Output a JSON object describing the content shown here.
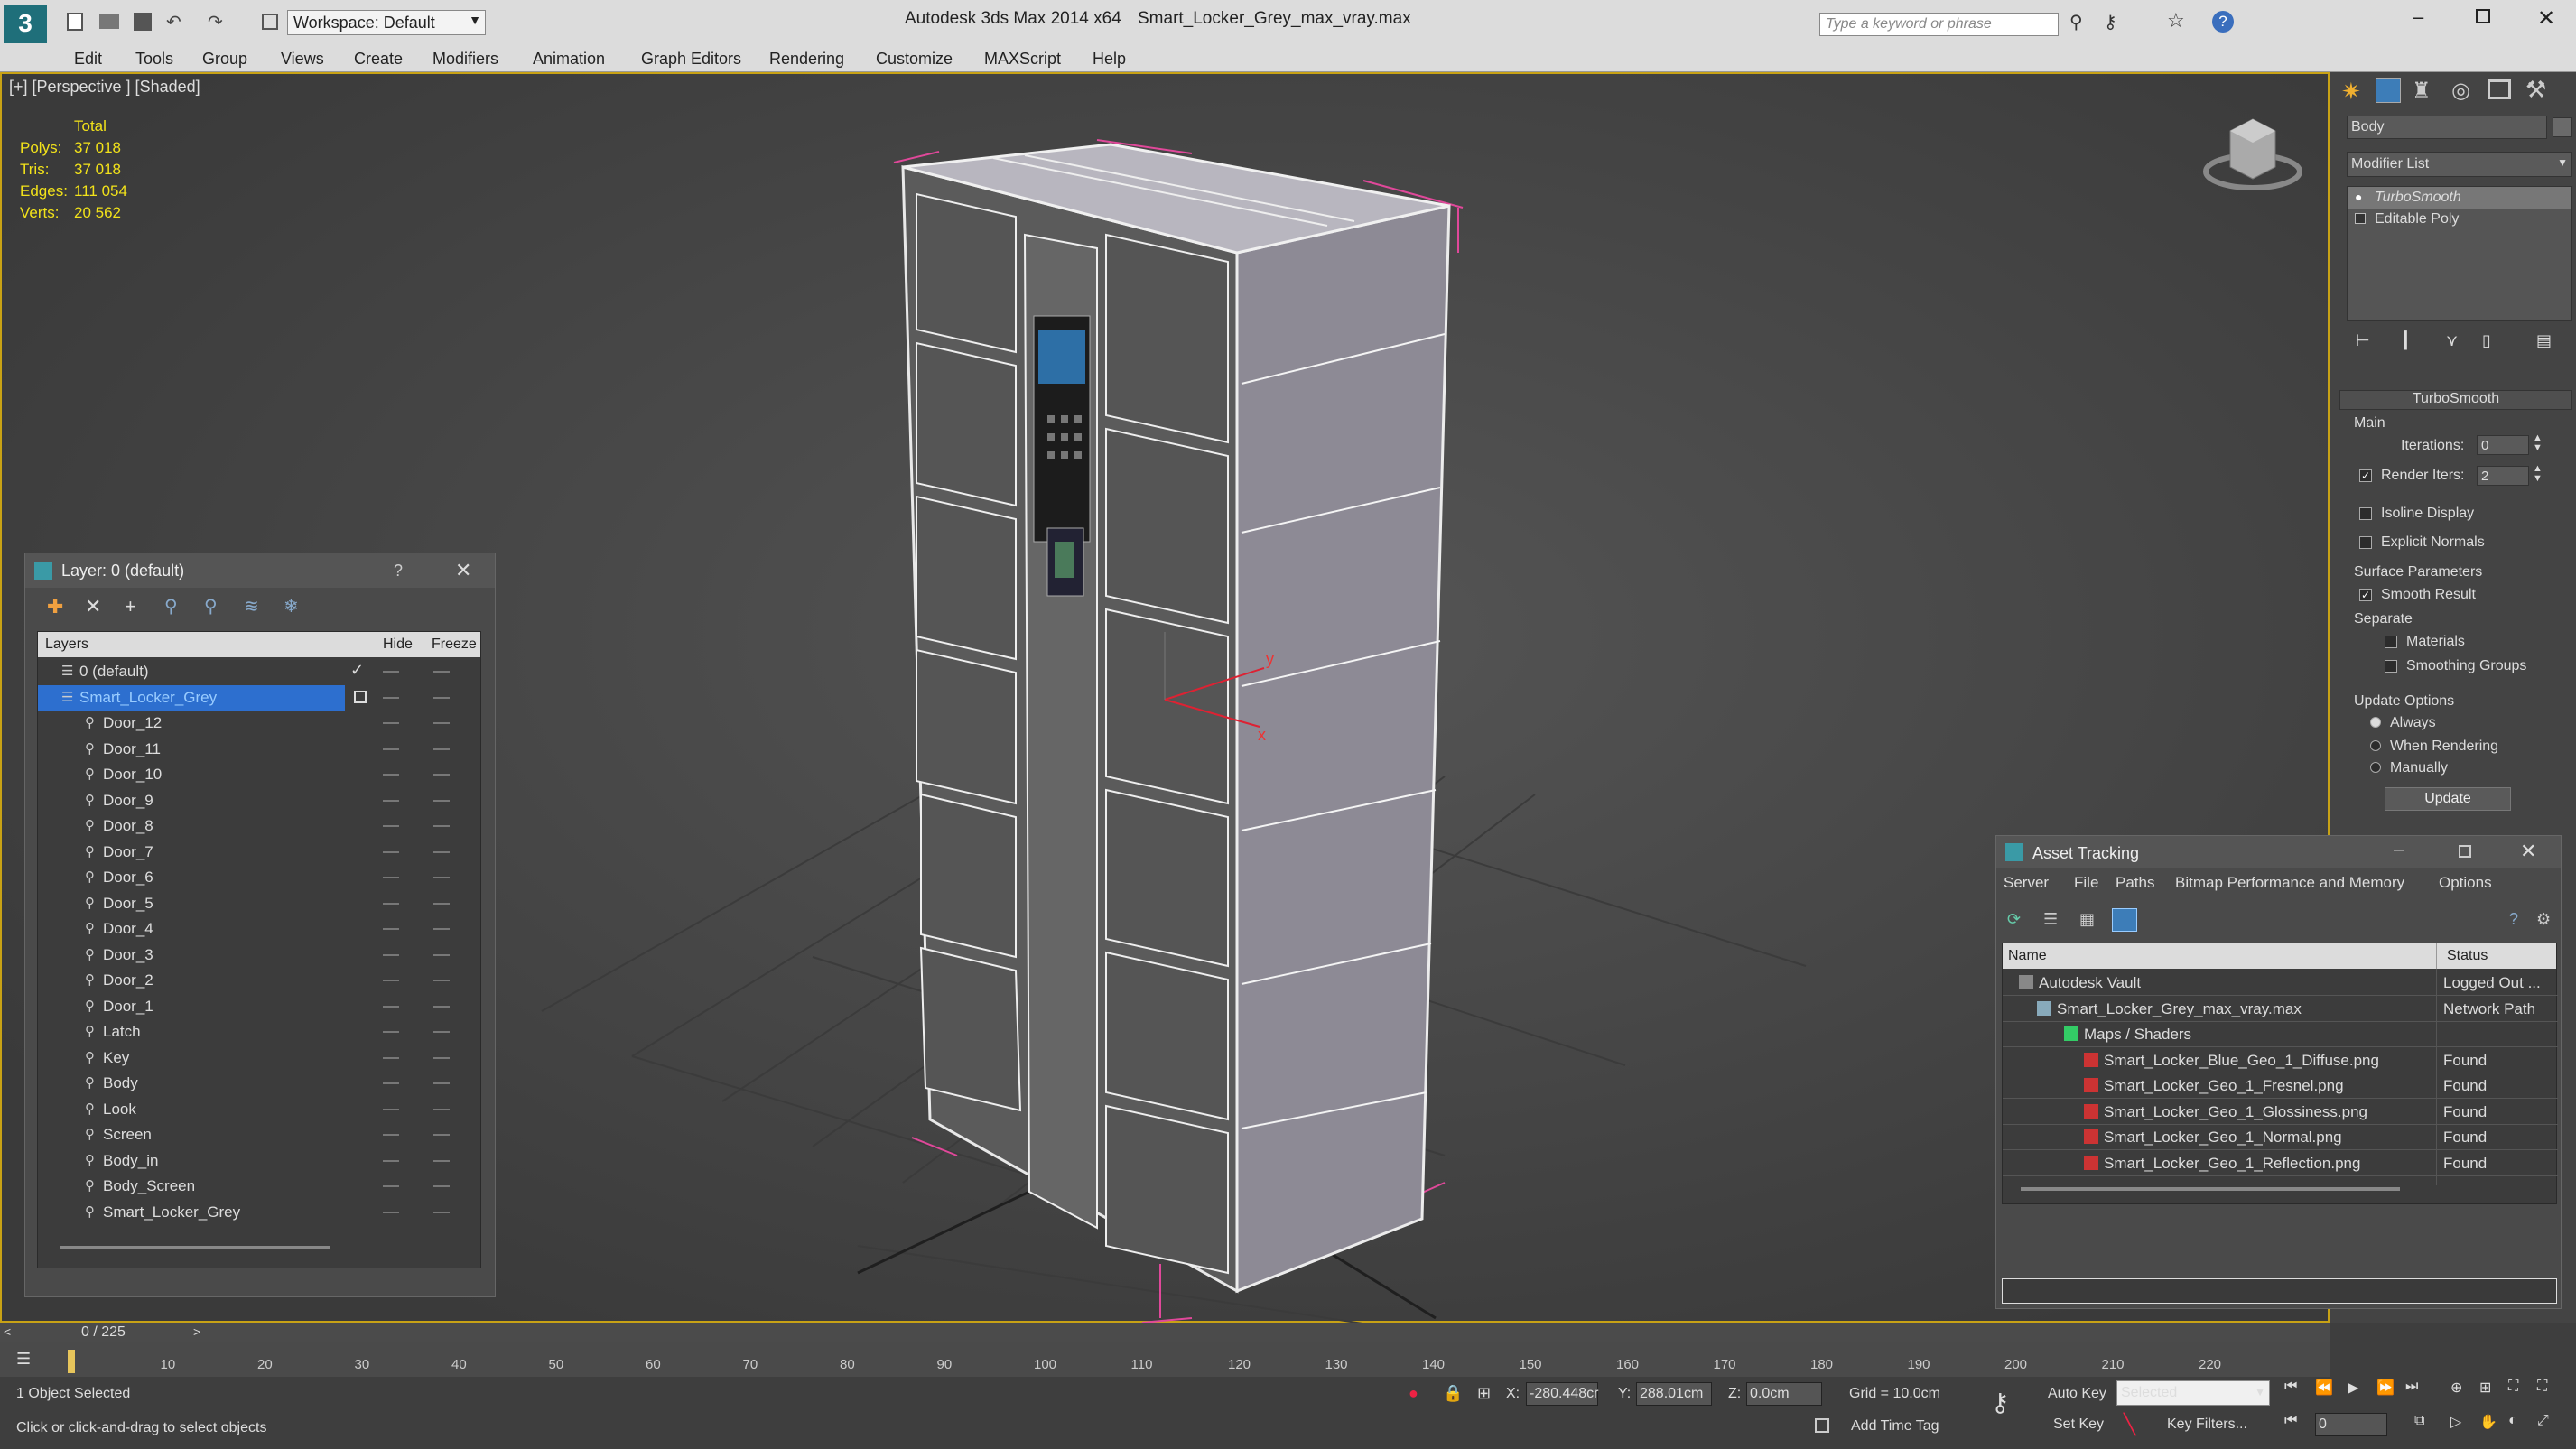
{
  "titlebar": {
    "app": "Autodesk 3ds Max  2014 x64",
    "file": "Smart_Locker_Grey_max_vray.max",
    "workspace": "Workspace: Default",
    "search_placeholder": "Type a keyword or phrase"
  },
  "menu": [
    "Edit",
    "Tools",
    "Group",
    "Views",
    "Create",
    "Modifiers",
    "Animation",
    "Graph Editors",
    "Rendering",
    "Customize",
    "MAXScript",
    "Help"
  ],
  "viewport": {
    "label": "[+] [Perspective ] [Shaded]",
    "stats": {
      "header": "Total",
      "rows": [
        {
          "k": "Polys:",
          "v": "37 018"
        },
        {
          "k": "Tris:",
          "v": "37 018"
        },
        {
          "k": "Edges:",
          "v": "111 054"
        },
        {
          "k": "Verts:",
          "v": "20 562"
        }
      ]
    },
    "axis_y": "y",
    "axis_x": "x"
  },
  "command_panel": {
    "object_name": "Body",
    "modifier_list": "Modifier List",
    "stack": [
      "TurboSmooth",
      "Editable Poly"
    ],
    "rollout_title": "TurboSmooth",
    "main": "Main",
    "iterations_label": "Iterations:",
    "iterations_value": "0",
    "render_iters_label": "Render Iters:",
    "render_iters_value": "2",
    "isoline": "Isoline Display",
    "explicit_normals": "Explicit Normals",
    "surface_params": "Surface Parameters",
    "smooth_result": "Smooth Result",
    "separate": "Separate",
    "materials": "Materials",
    "smoothing_groups": "Smoothing Groups",
    "update_options": "Update Options",
    "always": "Always",
    "when_rendering": "When Rendering",
    "manually": "Manually",
    "update_btn": "Update"
  },
  "layer_window": {
    "title": "Layer: 0 (default)",
    "help": "?",
    "col_layers": "Layers",
    "col_hide": "Hide",
    "col_freeze": "Freeze",
    "rows": [
      {
        "name": "0 (default)",
        "level": 0
      },
      {
        "name": "Smart_Locker_Grey",
        "level": 0
      },
      {
        "name": "Door_12",
        "level": 1
      },
      {
        "name": "Door_11",
        "level": 1
      },
      {
        "name": "Door_10",
        "level": 1
      },
      {
        "name": "Door_9",
        "level": 1
      },
      {
        "name": "Door_8",
        "level": 1
      },
      {
        "name": "Door_7",
        "level": 1
      },
      {
        "name": "Door_6",
        "level": 1
      },
      {
        "name": "Door_5",
        "level": 1
      },
      {
        "name": "Door_4",
        "level": 1
      },
      {
        "name": "Door_3",
        "level": 1
      },
      {
        "name": "Door_2",
        "level": 1
      },
      {
        "name": "Door_1",
        "level": 1
      },
      {
        "name": "Latch",
        "level": 1
      },
      {
        "name": "Key",
        "level": 1
      },
      {
        "name": "Body",
        "level": 1
      },
      {
        "name": "Look",
        "level": 1
      },
      {
        "name": "Screen",
        "level": 1
      },
      {
        "name": "Body_in",
        "level": 1
      },
      {
        "name": "Body_Screen",
        "level": 1
      },
      {
        "name": "Smart_Locker_Grey",
        "level": 1
      }
    ]
  },
  "asset_window": {
    "title": "Asset Tracking",
    "menu": [
      "Server",
      "File",
      "Paths",
      "Bitmap Performance and Memory",
      "Options"
    ],
    "col_name": "Name",
    "col_status": "Status",
    "rows": [
      {
        "name": "Autodesk Vault",
        "status": "Logged Out ...",
        "level": 0
      },
      {
        "name": "Smart_Locker_Grey_max_vray.max",
        "status": "Network Path",
        "level": 1
      },
      {
        "name": "Maps / Shaders",
        "status": "",
        "level": 2
      },
      {
        "name": "Smart_Locker_Blue_Geo_1_Diffuse.png",
        "status": "Found",
        "level": 3
      },
      {
        "name": "Smart_Locker_Geo_1_Fresnel.png",
        "status": "Found",
        "level": 3
      },
      {
        "name": "Smart_Locker_Geo_1_Glossiness.png",
        "status": "Found",
        "level": 3
      },
      {
        "name": "Smart_Locker_Geo_1_Normal.png",
        "status": "Found",
        "level": 3
      },
      {
        "name": "Smart_Locker_Geo_1_Reflection.png",
        "status": "Found",
        "level": 3
      }
    ]
  },
  "timeline": {
    "frame": "0 / 225",
    "ticks": [
      "10",
      "20",
      "30",
      "40",
      "50",
      "60",
      "70",
      "80",
      "90",
      "100",
      "110",
      "120",
      "130",
      "140",
      "150",
      "160",
      "170",
      "180",
      "190",
      "200",
      "210",
      "220"
    ]
  },
  "status": {
    "selected": "1 Object Selected",
    "hint": "Click or click-and-drag to select objects",
    "x_label": "X:",
    "x_value": "-280.448cr",
    "y_label": "Y:",
    "y_value": "288.01cm",
    "z_label": "Z:",
    "z_value": "0.0cm",
    "grid": "Grid = 10.0cm",
    "auto_key": "Auto Key",
    "selected_dropdown": "Selected",
    "set_key": "Set Key",
    "key_filters": "Key Filters...",
    "add_time_tag": "Add Time Tag",
    "frame_value": "0"
  }
}
